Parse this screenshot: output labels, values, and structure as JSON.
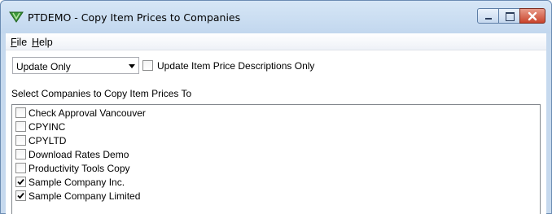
{
  "window": {
    "title": "PTDEMO - Copy Item Prices to Companies",
    "icon": "pt-app-icon",
    "controls": [
      "minimize-icon",
      "maximize-icon",
      "close-icon"
    ]
  },
  "menubar": {
    "file": "File",
    "help": "Help"
  },
  "options": {
    "mode_selected": "Update Only",
    "descriptions_only_label": "Update Item Price Descriptions Only",
    "descriptions_only_checked": false
  },
  "companies": {
    "label": "Select Companies to Copy Item Prices To",
    "items": [
      {
        "label": "Check Approval Vancouver",
        "checked": false
      },
      {
        "label": "CPYINC",
        "checked": false
      },
      {
        "label": "CPYLTD",
        "checked": false
      },
      {
        "label": "Download Rates Demo",
        "checked": false
      },
      {
        "label": "Productivity Tools Copy",
        "checked": false
      },
      {
        "label": "Sample Company Inc.",
        "checked": true
      },
      {
        "label": "Sample Company Limited",
        "checked": true
      }
    ]
  }
}
